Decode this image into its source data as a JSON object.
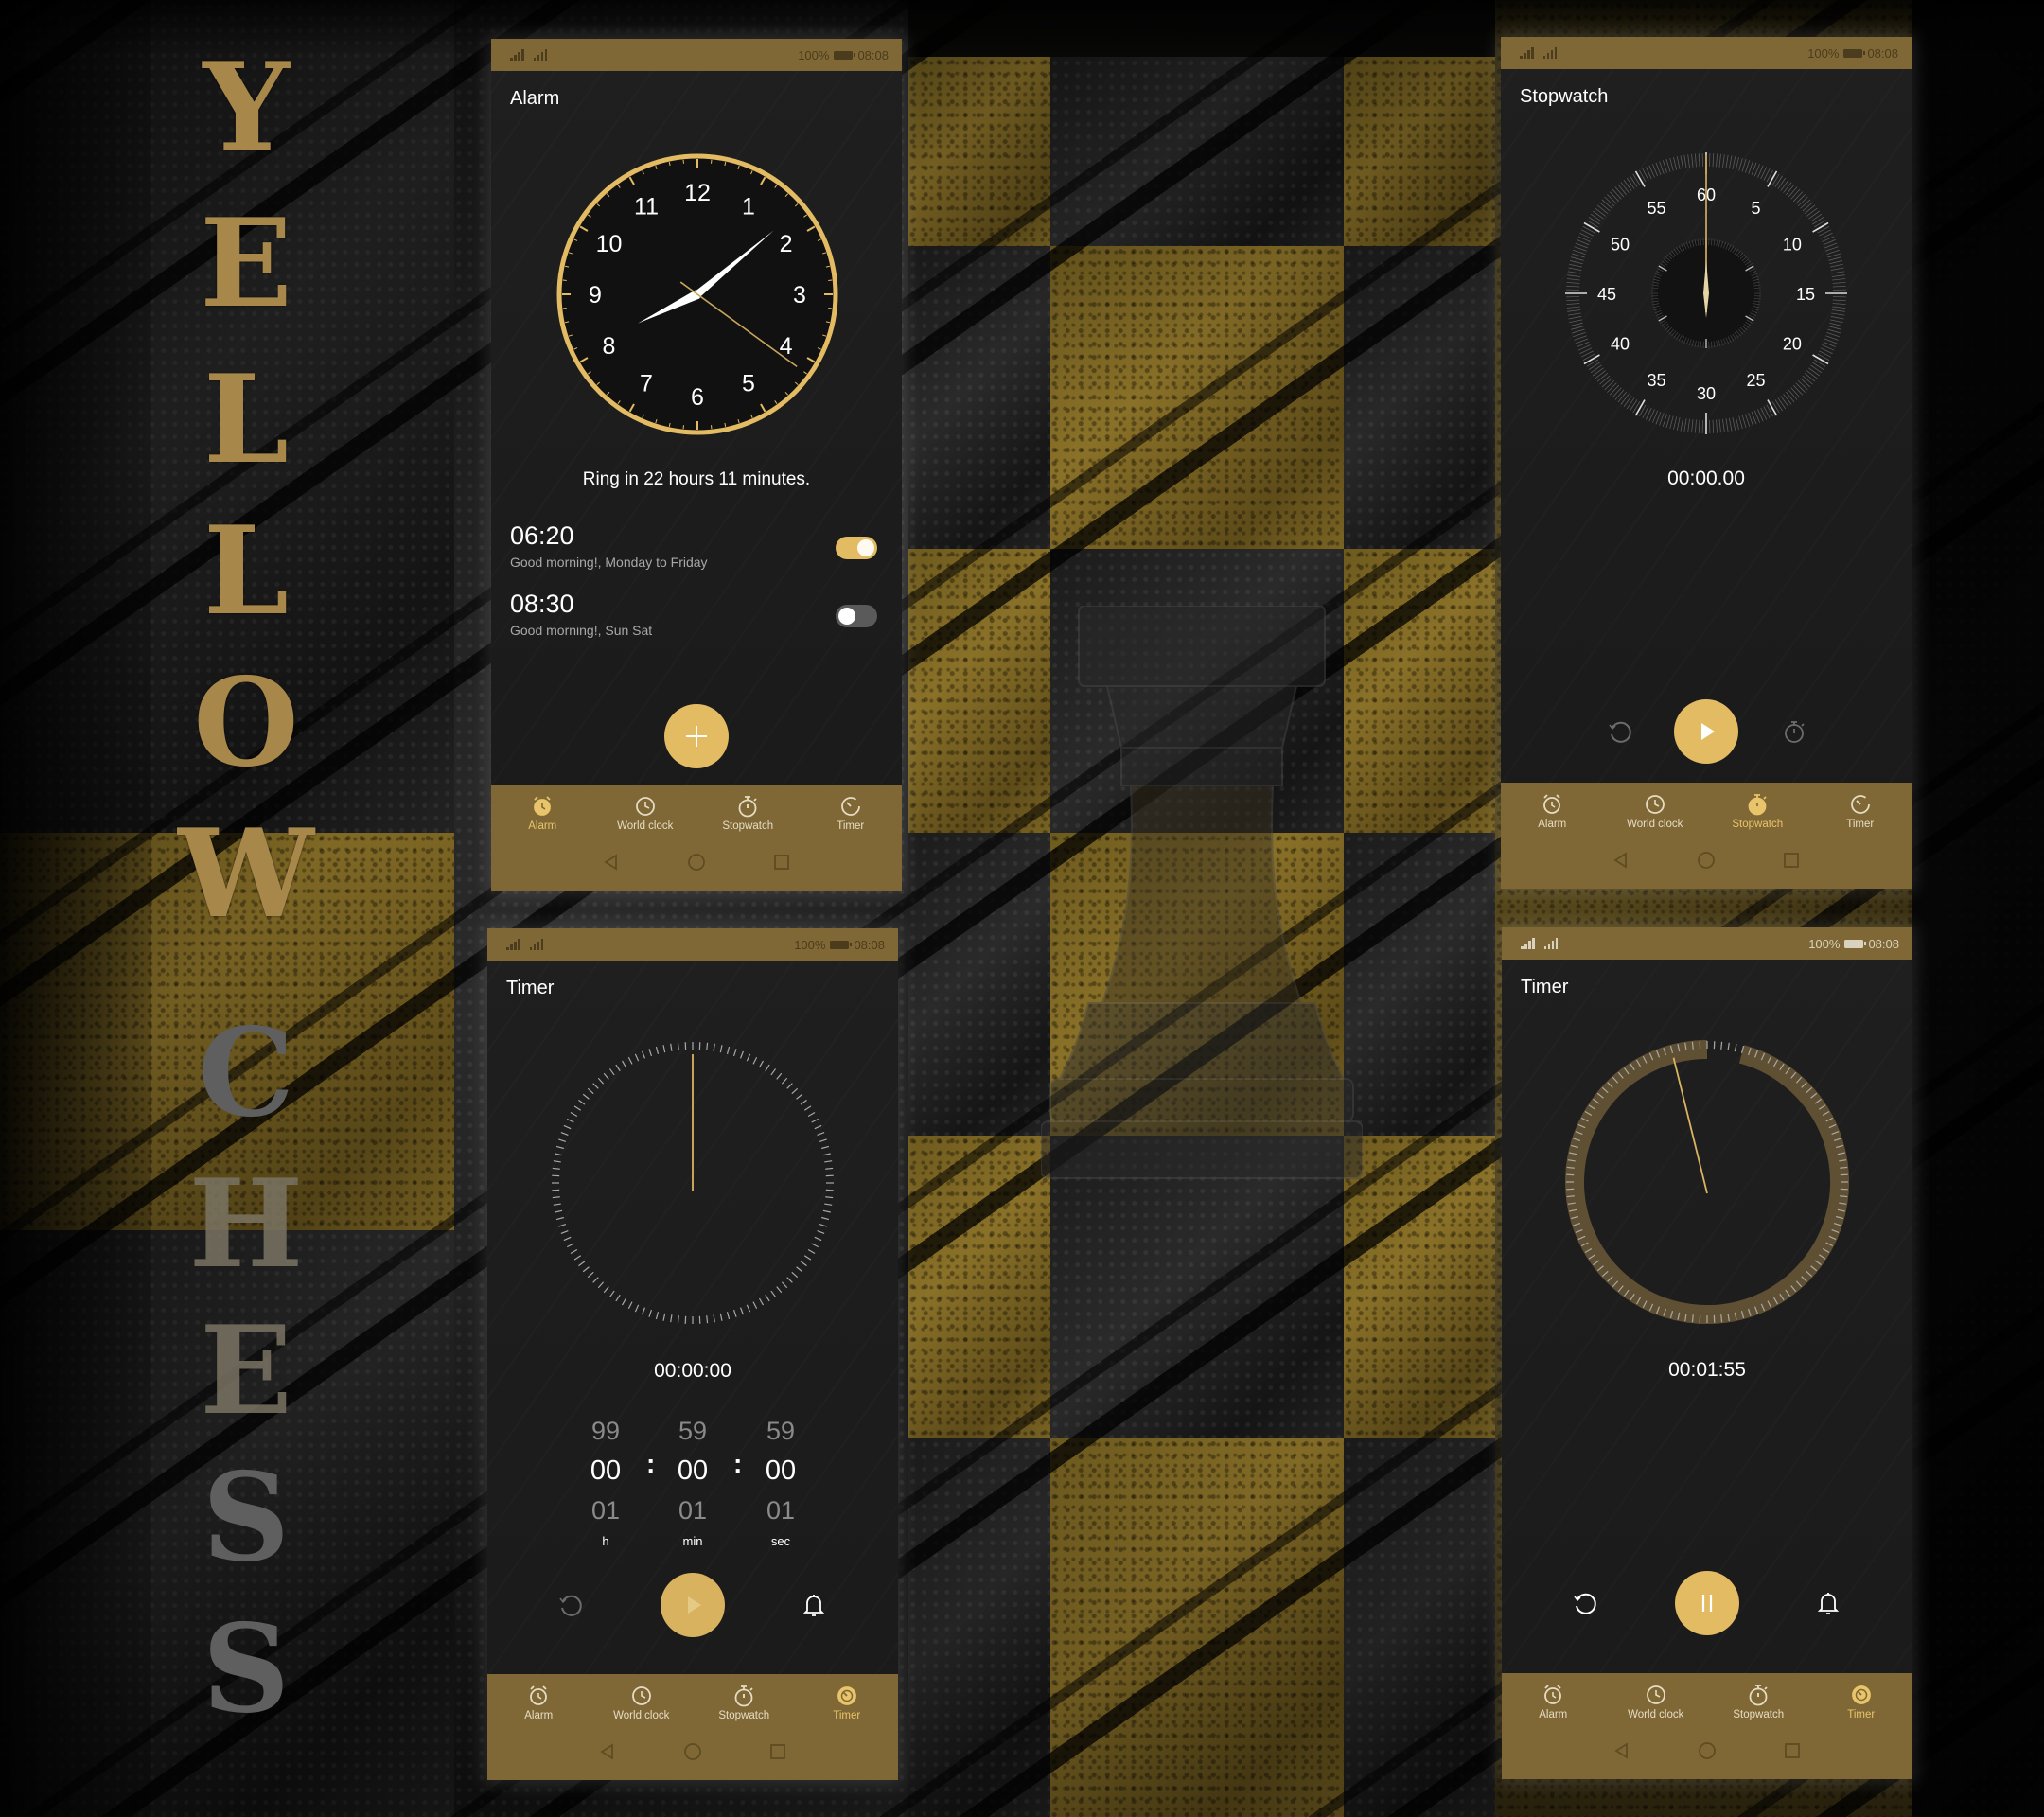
{
  "poster": {
    "title_word_1": [
      "Y",
      "E",
      "L",
      "L",
      "O",
      "W"
    ],
    "title_word_2": [
      "C",
      "H",
      "E",
      "S",
      "S"
    ]
  },
  "colors": {
    "accent": "#e3bb62",
    "bar": "#7f6836",
    "screen_bg": "#1c1c1c",
    "active_tab": "#e8c46b"
  },
  "status_bar": {
    "battery": "100%",
    "time": "08:08"
  },
  "tabs": [
    {
      "label": "Alarm",
      "icon": "alarm-clock-icon"
    },
    {
      "label": "World clock",
      "icon": "clock-icon"
    },
    {
      "label": "Stopwatch",
      "icon": "stopwatch-icon"
    },
    {
      "label": "Timer",
      "icon": "timer-icon"
    }
  ],
  "system_nav": [
    "back-icon",
    "home-icon",
    "recents-icon"
  ],
  "screens": {
    "alarm": {
      "title": "Alarm",
      "active_tab": "Alarm",
      "clock": {
        "numbers": [
          "12",
          "1",
          "2",
          "3",
          "4",
          "5",
          "6",
          "7",
          "8",
          "9",
          "10",
          "11"
        ],
        "time_shown": {
          "hour": 8,
          "minute": 8,
          "second": 21
        }
      },
      "ring_text": "Ring in 22 hours 11 minutes.",
      "alarms": [
        {
          "time": "06:20",
          "description": "Good morning!, Monday to Friday",
          "enabled": true
        },
        {
          "time": "08:30",
          "description": "Good morning!, Sun Sat",
          "enabled": false
        }
      ],
      "add_button": "add-alarm"
    },
    "stopwatch": {
      "title": "Stopwatch",
      "active_tab": "Stopwatch",
      "dial_numbers": [
        "60",
        "5",
        "10",
        "15",
        "20",
        "25",
        "30",
        "35",
        "40",
        "45",
        "50",
        "55"
      ],
      "readout": "00:00.00",
      "controls": [
        "reset",
        "start",
        "lap"
      ]
    },
    "timer_setup": {
      "title": "Timer",
      "active_tab": "Timer",
      "readout": "00:00:00",
      "picker": {
        "columns": [
          {
            "prev": "99",
            "current": "00",
            "next": "01",
            "unit": "h"
          },
          {
            "prev": "59",
            "current": "00",
            "next": "01",
            "unit": "min"
          },
          {
            "prev": "59",
            "current": "00",
            "next": "01",
            "unit": "sec"
          }
        ],
        "separator": ":"
      },
      "progress_fraction": 0,
      "controls": [
        "reset",
        "start",
        "ringtone"
      ]
    },
    "timer_running": {
      "title": "Timer",
      "active_tab": "Timer",
      "readout": "00:01:55",
      "progress_fraction": 0.958,
      "controls": [
        "reset",
        "pause",
        "ringtone"
      ]
    }
  }
}
